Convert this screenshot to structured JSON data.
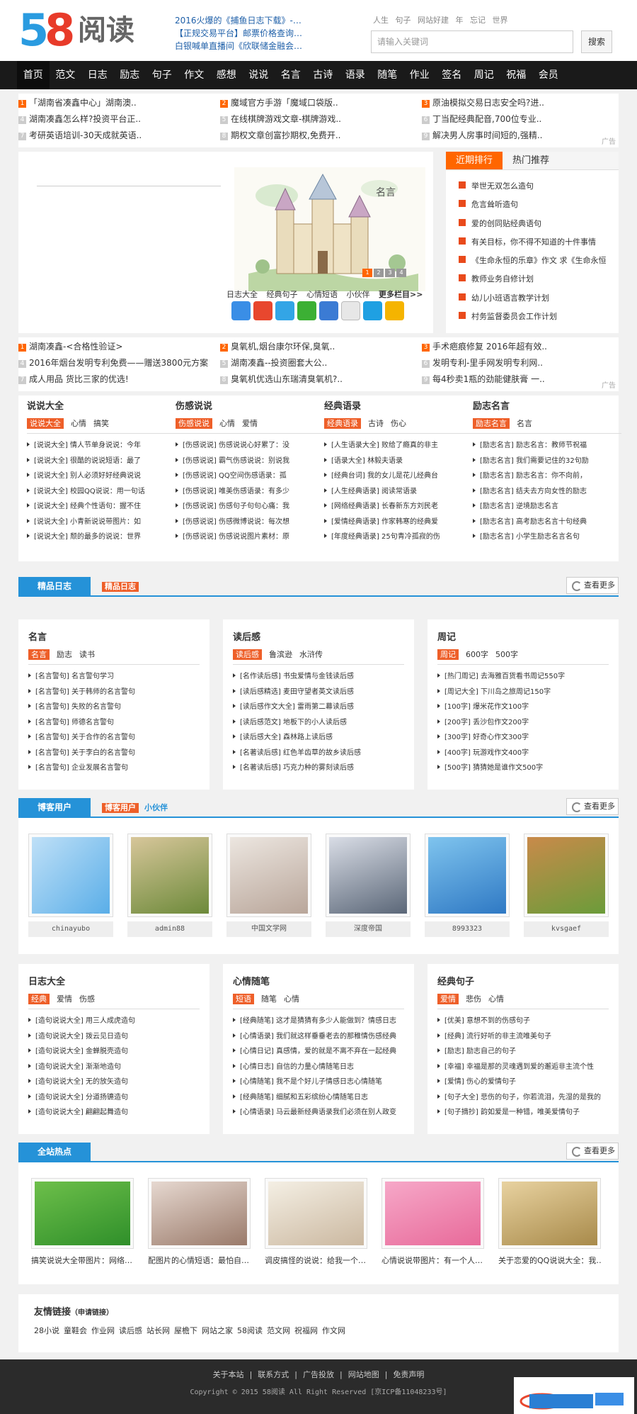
{
  "logo": {
    "num": "58",
    "text": "阅读"
  },
  "header": {
    "hotnews": [
      "2016火爆的《捕鱼日志下载》-…",
      "【正规交易平台】邮票价格查询…",
      "白银喊单直播间《欣联储金融会…"
    ],
    "keywords": [
      "人生",
      "句子",
      "网站好建",
      "年",
      "忘记",
      "世界"
    ],
    "search_placeholder": "请输入关键词",
    "search_button": "搜索"
  },
  "nav": [
    "首页",
    "范文",
    "日志",
    "励志",
    "句子",
    "作文",
    "感想",
    "说说",
    "名言",
    "古诗",
    "语录",
    "随笔",
    "作业",
    "签名",
    "周记",
    "祝福",
    "会员"
  ],
  "ads1": [
    {
      "n": "1",
      "t": "「湖南省凑鑫中心」湖南澳.."
    },
    {
      "n": "4",
      "t": "湖南凑鑫怎么样?投资平台正.."
    },
    {
      "n": "7",
      "t": "考研英语培训-30天成就英语.."
    },
    {
      "n": "2",
      "t": "魔域官方手游「魔域口袋版.."
    },
    {
      "n": "5",
      "t": "在线棋牌游戏文章-棋牌游戏.."
    },
    {
      "n": "8",
      "t": "期权文章创富抄期权,免费开.."
    },
    {
      "n": "3",
      "t": "原油模拟交易日志安全吗?进.."
    },
    {
      "n": "6",
      "t": "丁当配经典配音,700位专业.."
    },
    {
      "n": "9",
      "t": "解决男人房事时间短的,强精.."
    }
  ],
  "ad_tag": "广告",
  "banner": {
    "cats": [
      "日志大全",
      "经典句子",
      "心情短语",
      "小伙伴",
      "更多栏目>>"
    ],
    "dots": [
      "1",
      "2",
      "3",
      "4"
    ]
  },
  "hot": {
    "tabs": [
      "近期排行",
      "热门推荐"
    ],
    "items": [
      "举世无双怎么造句",
      "危言耸听造句",
      "爱的创同贴经典语句",
      "有关目标，你不得不知道的十件事情",
      "《生命永恒的乐章》作文 求《生命永恒",
      "教师业务自修计划",
      "幼儿小班语言教学计划",
      "村务监督委员会工作计划"
    ]
  },
  "ads2": [
    {
      "n": "1",
      "t": "湖南凑鑫-<合格性验证>"
    },
    {
      "n": "4",
      "t": "2016年烟台发明专利免费——赠送3800元方案!"
    },
    {
      "n": "7",
      "t": "成人用品 货比三家的优选!"
    },
    {
      "n": "2",
      "t": "臭氧机,烟台康尔环保,臭氧.."
    },
    {
      "n": "5",
      "t": "湖南凑鑫--投资圈套大公.."
    },
    {
      "n": "8",
      "t": "臭氧机优选山东瑞清臭氧机?.."
    },
    {
      "n": "3",
      "t": "手术疤痕修复 2016年超有效.."
    },
    {
      "n": "6",
      "t": "发明专利-里手网发明专利网.."
    },
    {
      "n": "9",
      "t": "每4秒卖1瓶的劲能健肤膏 一.."
    }
  ],
  "cols4": [
    {
      "title": "说说大全",
      "tabs": [
        "说说大全",
        "心情",
        "搞笑"
      ],
      "items": [
        "[说说大全] 情人节单身说说：今年",
        "[说说大全] 很酷的说说短语：最了",
        "[说说大全] 别人必须好好经典说说",
        "[说说大全] 校园QQ说说：用一句话",
        "[说说大全] 经典个性语句：握不住",
        "[说说大全] 小青新说说带图片：如",
        "[说说大全] 颓的最多的说说：世界"
      ]
    },
    {
      "title": "伤感说说",
      "tabs": [
        "伤感说说",
        "心情",
        "爱情"
      ],
      "items": [
        "[伤感说说] 伤感说说心好累了：没",
        "[伤感说说] 霸气伤感说说：别说我",
        "[伤感说说] QQ空间伤感语录：孤",
        "[伤感说说] 唯美伤感语录：有多少",
        "[伤感说说] 伤感句子句句心痛：我",
        "[伤感说说] 伤感微博说说：每次想",
        "[伤感说说] 伤感说说图片素材：原"
      ]
    },
    {
      "title": "经典语录",
      "tabs": [
        "经典语录",
        "古诗",
        "伤心"
      ],
      "items": [
        "[人生语录大全] 败给了瘾真的非主",
        "[语录大全] 林毅夫语录",
        "[经典台词] 我的女儿是花儿经典台",
        "[人生经典语录] 阅读常语录",
        "[网络经典语录] 长春新东方刘民老",
        "[爱情经典语录] 作家韩寒的经典爱",
        "[年度经典语录] 25句青冷孤寂的伤"
      ]
    },
    {
      "title": "励志名言",
      "tabs": [
        "励志名言",
        "名言"
      ],
      "items": [
        "[励志名言] 励志名言：教师节祝福",
        "[励志名言] 我们需要记住的32句励",
        "[励志名言] 励志名言：你不向前，",
        "[励志名言] 结夫去方向女性的励志",
        "[励志名言] 逆境励志名言",
        "[励志名言] 高考励志名言十句经典",
        "[励志名言] 小学生励志名言名句"
      ]
    }
  ],
  "sec_diary": {
    "lbl": "精品日志",
    "lbl2": "精品日志",
    "more": "查看更多"
  },
  "cols3a": [
    {
      "title": "名言",
      "tabs": [
        "名言",
        "励志",
        "读书"
      ],
      "items": [
        "[名言警句] 名言警句学习",
        "[名言警句] 关于韩师的名言警句",
        "[名言警句] 失败的名言警句",
        "[名言警句] 师德名言警句",
        "[名言警句] 关于合作的名言警句",
        "[名言警句] 关于李白的名言警句",
        "[名言警句] 企业发展名言警句"
      ]
    },
    {
      "title": "读后感",
      "tabs": [
        "读后感",
        "鲁滨逊",
        "水浒传"
      ],
      "items": [
        "[名作读后感] 书虫爱情与金钱读后感",
        "[读后感精选] 麦田守望者英文读后感",
        "[读后感作文大全] 雷雨第二幕读后感",
        "[读后感范文] 地板下的小人读后感",
        "[读后感大全] 森林路上读后感",
        "[名著读后感] 红色羊齿草的故乡读后感",
        "[名著读后感] 巧克力种的雾刻读后感"
      ]
    },
    {
      "title": "周记",
      "tabs": [
        "周记",
        "600字",
        "500字"
      ],
      "items": [
        "[热门周记] 去海雅百货看书周记550字",
        "[周记大全] 下川岛之旅周记150字",
        "[100字] 爆米花作文100字",
        "[200字] 丢沙包作文200字",
        "[300字] 好奇心作文300字",
        "[400字] 玩游戏作文400字",
        "[500字] 猜猜她是谁作文500字"
      ]
    }
  ],
  "sec_blog": {
    "lbl": "博客用户",
    "lbl2": "博客用户",
    "lbl3": "小伙伴",
    "more": "查看更多"
  },
  "blogs": [
    "chinayubo",
    "admin88",
    "中国文学网",
    "深度帝国",
    "8993323",
    "kvsgaef"
  ],
  "cols3b": [
    {
      "title": "日志大全",
      "tabs": [
        "经典",
        "爱情",
        "伤感"
      ],
      "items": [
        "[造句说说大全] 用三人成虎造句",
        "[造句说说大全] 拨云见日造句",
        "[造句说说大全] 金蝉脱壳造句",
        "[造句说说大全] 渐渐地造句",
        "[造句说说大全] 无的放矢造句",
        "[造句说说大全] 分道扬镳造句",
        "[造句说说大全] 翩翩起舞造句"
      ]
    },
    {
      "title": "心情随笔",
      "tabs": [
        "短语",
        "随笔",
        "心情"
      ],
      "items": [
        "[经典随笔] 这才是猜猜有多少人能做到？情感日志",
        "[心情语录] 我们就这样垂垂老去的那稚情伤感经典",
        "[心情日记] 真感情，爱的就是不离不弃在一起经典",
        "[心情日志] 自信的力量心情随笔日志",
        "[心情随笔] 我不是个好儿子情感日志心情随笔",
        "[经典随笔] 细腻和五彩缤纷心情随笔日志",
        "[心情语录] 马云最新经典语录我们必须在别人政变"
      ]
    },
    {
      "title": "经典句子",
      "tabs": [
        "爱情",
        "悲伤",
        "心情"
      ],
      "items": [
        "[优美] 意想不到的伤感句子",
        "[经典] 流行好听的非主流唯美句子",
        "[励志] 励志自己的句子",
        "[幸福] 幸福是那的灵魂遇到爱的邂逅非主流个性",
        "[爱情] 伤心的爱情句子",
        "[句子大全] 悲伤的句子，你若流泪，先湿的是我的",
        "[句子摘抄] 韵如爱是一种错，唯美爱情句子"
      ]
    }
  ],
  "sec_hot": {
    "lbl": "全站热点",
    "more": "查看更多"
  },
  "hots": [
    "搞笑说说大全带图片：网络…",
    "配图片的心情短语：最怕自…",
    "调皮搞怪的说说：给我一个…",
    "心情说说带图片：有一个人…",
    "关于恋爱的QQ说说大全：我…"
  ],
  "friends": {
    "title": "友情链接",
    "apply": "（申请链接）",
    "links": [
      "28小说",
      "童鞋会",
      "作业网",
      "读后感",
      "站长网",
      "屋檐下",
      "网站之家",
      "58阅读",
      "范文网",
      "祝福网",
      "作文网"
    ]
  },
  "footer": {
    "links": [
      "关于本站",
      "|",
      "联系方式",
      "|",
      "广告投放",
      "|",
      "网站地图",
      "|",
      "免责声明"
    ],
    "copyright": "Copyright © 2015 58阅读 All Right Reserved [京ICP备11048233号]"
  }
}
